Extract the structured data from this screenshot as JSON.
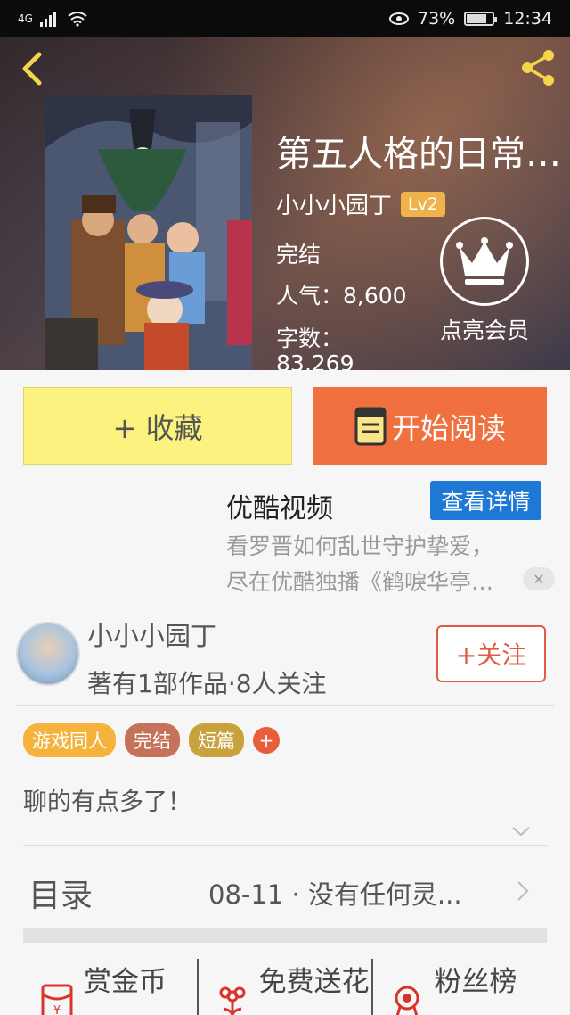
{
  "status_bar": {
    "network": "4G",
    "battery": "73%",
    "time": "12:34"
  },
  "book": {
    "title": "第五人格的日常…",
    "author": "小小小园丁",
    "author_level": "Lv2",
    "status": "完结",
    "popularity": "人气：8,600",
    "word_count_label": "字数：",
    "word_count": "83,269"
  },
  "vip": {
    "label": "点亮会员"
  },
  "actions": {
    "collect": "+ 收藏",
    "read": "开始阅读"
  },
  "ad": {
    "title": "优酷视频",
    "button": "查看详情",
    "line1": "看罗晋如何乱世守护挚爱，",
    "line2": "尽在优酷独播《鹤唳华亭…",
    "close": "✕"
  },
  "author_card": {
    "name": "小小小园丁",
    "stats": "著有1部作品·8人关注",
    "follow": "+关注"
  },
  "tags": [
    {
      "label": "游戏同人",
      "color": "#f5b33d"
    },
    {
      "label": "完结",
      "color": "#c4725a"
    },
    {
      "label": "短篇",
      "color": "#c9a23e"
    }
  ],
  "tag_add": "+",
  "description": "聊的有点多了！",
  "toc": {
    "label": "目录",
    "latest": "08-11 · 没有任何灵..."
  },
  "bottom_tabs": [
    {
      "label": "赏金币",
      "icon": "red-envelope-icon"
    },
    {
      "label": "免费送花",
      "icon": "flower-icon"
    },
    {
      "label": "粉丝榜",
      "icon": "medal-icon"
    }
  ]
}
